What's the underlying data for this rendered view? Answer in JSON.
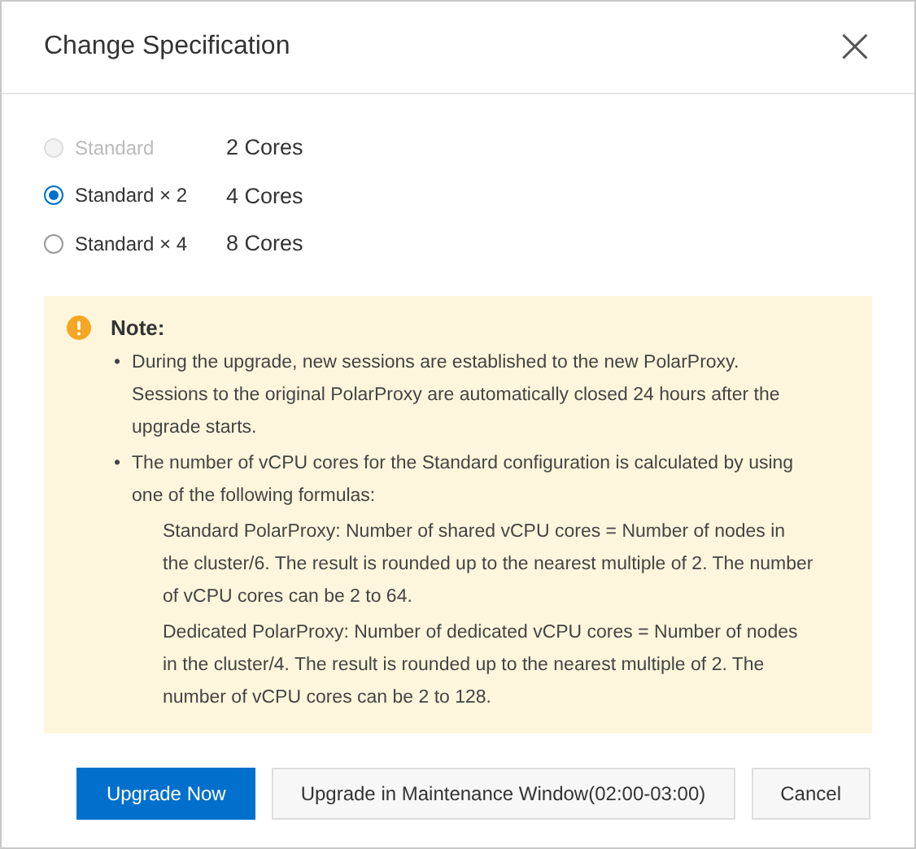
{
  "dialog": {
    "title": "Change Specification",
    "close": "×"
  },
  "options": [
    {
      "label": "Standard",
      "cores": "2 Cores",
      "selected": false,
      "disabled": true
    },
    {
      "label": "Standard × 2",
      "cores": "4 Cores",
      "selected": true,
      "disabled": false
    },
    {
      "label": "Standard × 4",
      "cores": "8 Cores",
      "selected": false,
      "disabled": false
    }
  ],
  "note": {
    "title": "Note:",
    "bullets": [
      {
        "marker": "•",
        "text": "During the upgrade, new sessions are established to the new PolarProxy. Sessions to the original PolarProxy are automatically closed 24 hours after the upgrade starts."
      },
      {
        "marker": "•",
        "text": "The number of vCPU cores for the Standard configuration is calculated by using one of the following formulas:"
      }
    ],
    "formulas": [
      "Standard PolarProxy: Number of shared vCPU cores = Number of nodes in the cluster/6. The result is rounded up to the nearest multiple of 2. The number of vCPU cores can be 2 to 64.",
      "Dedicated PolarProxy: Number of dedicated vCPU cores = Number of nodes in the cluster/4. The result is rounded up to the nearest multiple of 2. The number of vCPU cores can be 2 to 128."
    ]
  },
  "buttons": [
    {
      "label": "Upgrade Now",
      "kind": "primary"
    },
    {
      "label": "Upgrade in Maintenance Window(02:00-03:00)",
      "kind": "secondary"
    },
    {
      "label": "Cancel",
      "kind": "secondary"
    }
  ]
}
